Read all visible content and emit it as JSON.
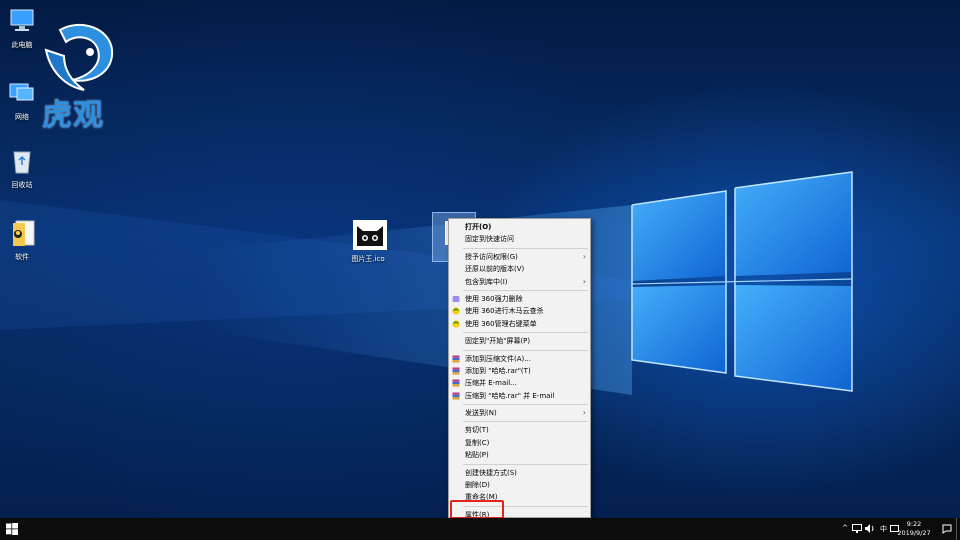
{
  "desktop": {
    "logo_text": "虎观",
    "icons": [
      {
        "label": "此电脑"
      },
      {
        "label": "网络"
      },
      {
        "label": "回收站"
      },
      {
        "label": "软件"
      },
      {
        "label": "图片王.ico"
      }
    ]
  },
  "context_menu": {
    "items": [
      {
        "label": "打开(O)",
        "bold": true
      },
      {
        "label": "固定到快速访问"
      },
      {
        "label": "授予访问权限(G)",
        "submenu": true
      },
      {
        "label": "还原以前的版本(V)"
      },
      {
        "label": "包含到库中(I)",
        "submenu": true
      },
      {
        "label": "使用 360强力删除",
        "icon": "360-shred-icon"
      },
      {
        "label": "使用 360进行木马云查杀",
        "icon": "360-scan-icon"
      },
      {
        "label": "使用 360管理右键菜单",
        "icon": "360-menu-icon"
      },
      {
        "label": "固定到\"开始\"屏幕(P)"
      },
      {
        "label": "添加到压缩文件(A)...",
        "icon": "winrar-icon"
      },
      {
        "label": "添加到 \"哈哈.rar\"(T)",
        "icon": "winrar-icon"
      },
      {
        "label": "压缩并 E-mail...",
        "icon": "winrar-icon"
      },
      {
        "label": "压缩到 \"哈哈.rar\" 并 E-mail",
        "icon": "winrar-icon"
      },
      {
        "label": "发送到(N)",
        "submenu": true
      },
      {
        "label": "剪切(T)"
      },
      {
        "label": "复制(C)"
      },
      {
        "label": "粘贴(P)"
      },
      {
        "label": "创建快捷方式(S)"
      },
      {
        "label": "删除(D)"
      },
      {
        "label": "重命名(M)"
      },
      {
        "label": "属性(R)",
        "highlighted": true
      }
    ],
    "submenu_arrow": "›"
  },
  "taskbar": {
    "tray_up_arrow": "^",
    "ime": "中",
    "time": "9:22",
    "date": "2019/9/27"
  },
  "colors": {
    "highlight_border": "#e0241c",
    "menu_bg": "#f2f2f2",
    "logo_blue": "#2d8fe0"
  }
}
